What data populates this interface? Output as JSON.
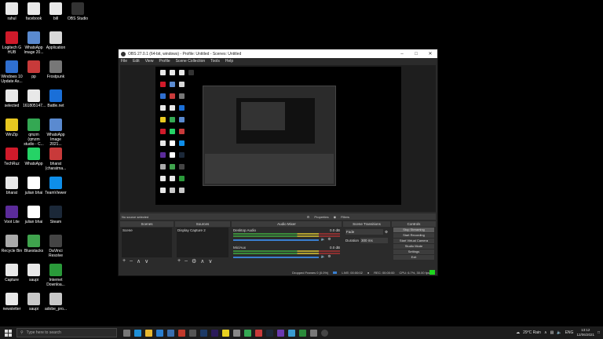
{
  "desktop_icons": [
    {
      "label": "rahul",
      "color": "#e8e8e8"
    },
    {
      "label": "facebook",
      "color": "#e8e8e8"
    },
    {
      "label": "bill",
      "color": "#e8e8e8"
    },
    {
      "label": "OBS Studio",
      "color": "#333333"
    },
    {
      "label": "Logitech G HUB",
      "color": "#d01a2a"
    },
    {
      "label": "WhatsApp Image 20...",
      "color": "#5a8ad0"
    },
    {
      "label": "Application",
      "color": "#d8d8d8"
    },
    {
      "label": "Windows 10 Update As...",
      "color": "#2f6fd0"
    },
    {
      "label": "pp",
      "color": "#c83a3a"
    },
    {
      "label": "Frostpunk",
      "color": "#777777"
    },
    {
      "label": "selected",
      "color": "#e8e8e8"
    },
    {
      "label": "161805147...",
      "color": "#e8e8e8"
    },
    {
      "label": "Battle.net",
      "color": "#1a6fd8"
    },
    {
      "label": "WinZip",
      "color": "#e8c820"
    },
    {
      "label": "qmzm (qmzm studio - C...",
      "color": "#34a853"
    },
    {
      "label": "WhatsApp Image 2021...",
      "color": "#5a8ad0"
    },
    {
      "label": "TechRuz",
      "color": "#d01a2a"
    },
    {
      "label": "WhatsApp",
      "color": "#25d366"
    },
    {
      "label": "bharat (charatma...",
      "color": "#c83a3a"
    },
    {
      "label": "bharat",
      "color": "#e8e8e8"
    },
    {
      "label": "julian bhai",
      "color": "#ffffff"
    },
    {
      "label": "TeamViewer",
      "color": "#0e8ee9"
    },
    {
      "label": "Voot Lite",
      "color": "#5b2b9a"
    },
    {
      "label": "julian bhai",
      "color": "#ffffff"
    },
    {
      "label": "Steam",
      "color": "#1b2838"
    },
    {
      "label": "Recycle Bin",
      "color": "#aaaaaa"
    },
    {
      "label": "Bluestacks",
      "color": "#3fa34d"
    },
    {
      "label": "DaVinci Resolve",
      "color": "#444444"
    },
    {
      "label": "Capture",
      "color": "#e8e8e8"
    },
    {
      "label": "saupi",
      "color": "#e8e8e8"
    },
    {
      "label": "Internet Downloa...",
      "color": "#2a9a3a"
    },
    {
      "label": "newsletter",
      "color": "#e8e8e8"
    },
    {
      "label": "saupi",
      "color": "#c8c8c8"
    },
    {
      "label": "adobe_pro...",
      "color": "#c8c8c8"
    }
  ],
  "obs": {
    "title": "OBS 27.0.1 (64-bit, windows) - Profile: Untitled - Scenes: Untitled",
    "menu": [
      "File",
      "Edit",
      "View",
      "Profile",
      "Scene Collection",
      "Tools",
      "Help"
    ],
    "source_bar": {
      "no_source": "No source selected",
      "properties": "Properties",
      "filters": "Filters"
    },
    "docks": {
      "scenes": {
        "title": "Scenes",
        "items": [
          "Scene"
        ]
      },
      "sources": {
        "title": "Sources",
        "items": [
          "Display Capture 2"
        ]
      },
      "mixer": {
        "title": "Audio Mixer",
        "tracks": [
          {
            "name": "Desktop Audio",
            "db": "0.0 dB"
          },
          {
            "name": "Mic/Aux",
            "db": "0.0 dB"
          }
        ]
      },
      "transitions": {
        "title": "Scene Transitions",
        "type": "Fade",
        "duration_label": "Duration",
        "duration": "300 ms"
      },
      "controls": {
        "title": "Controls",
        "buttons": [
          "Stop Streaming",
          "Start Recording",
          "Start Virtual Camera",
          "Studio Mode",
          "Settings",
          "Exit"
        ]
      }
    },
    "status": {
      "dropped": "Dropped Frames 0 (0.0%)",
      "live": "LIVE: 00:00:02",
      "rec": "REC: 00:00:00",
      "cpu": "CPU: 6.7%, 30.00 fps"
    }
  },
  "taskbar": {
    "search_placeholder": "Type here to search",
    "weather": "29°C Rain",
    "lang": "ENG",
    "time": "13:12",
    "date": "12/06/2021"
  }
}
